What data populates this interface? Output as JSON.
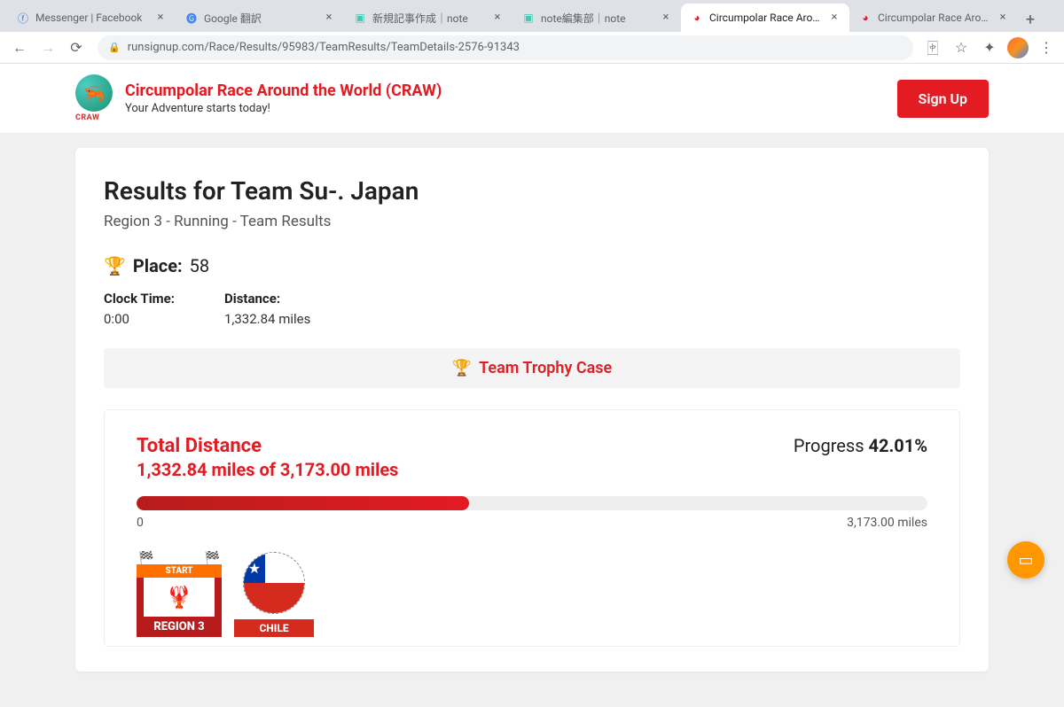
{
  "browser": {
    "tabs": [
      {
        "favicon": "fb",
        "title": "Messenger | Facebook"
      },
      {
        "favicon": "gt",
        "title": "Google 翻訳"
      },
      {
        "favicon": "note",
        "title": "新規記事作成｜note"
      },
      {
        "favicon": "note",
        "title": "note編集部｜note"
      },
      {
        "favicon": "rs",
        "title": "Circumpolar Race Around",
        "active": true
      },
      {
        "favicon": "rs",
        "title": "Circumpolar Race Around"
      }
    ],
    "url": "runsignup.com/Race/Results/95983/TeamResults/TeamDetails-2576-91343"
  },
  "header": {
    "title": "Circumpolar Race Around the World (CRAW)",
    "tagline": "Your Adventure starts today!",
    "signup": "Sign Up",
    "logo_caption": "CRAW"
  },
  "results": {
    "heading": "Results for Team Su-. Japan",
    "subheading": "Region 3 - Running - Team Results",
    "place_label": "Place:",
    "place_value": "58",
    "clock_label": "Clock Time:",
    "clock_value": "0:00",
    "distance_label": "Distance:",
    "distance_value": "1,332.84 miles",
    "trophy_case": "Team Trophy Case"
  },
  "progress": {
    "total_label": "Total Distance",
    "total_value": "1,332.84 miles of 3,173.00 miles",
    "progress_label": "Progress",
    "progress_pct": "42.01%",
    "bar_pct": 42.01,
    "scale_start": "0",
    "scale_end": "3,173.00 miles",
    "region3_start": "START",
    "region3_label": "REGION 3",
    "chile_label": "CHILE"
  }
}
